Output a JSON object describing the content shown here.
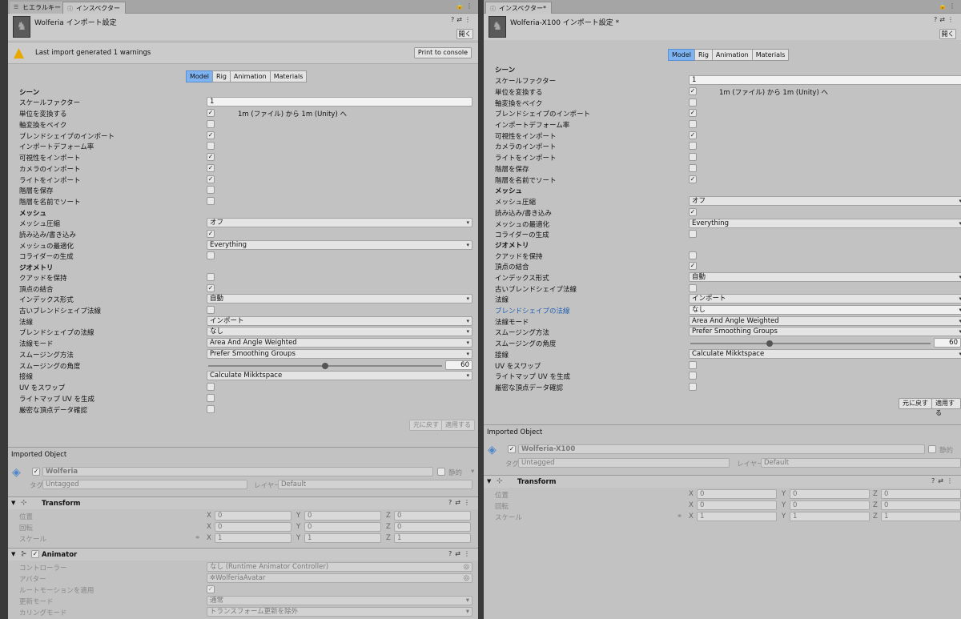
{
  "left": {
    "tabs": [
      {
        "label": "ヒエラルキー"
      },
      {
        "label": "インスペクター"
      }
    ],
    "title": "Wolferia インポート設定",
    "open_label": "開く",
    "warning": "Last import generated 1 warnings",
    "print_console": "Print to console",
    "mtabs": [
      "Model",
      "Rig",
      "Animation",
      "Materials"
    ],
    "scene_h": "シーン",
    "scale_factor_l": "スケールファクター",
    "scale_factor_v": "1",
    "convert_units_l": "単位を変換する",
    "convert_units_note": "1m (ファイル) から 1m (Unity) へ",
    "bake_axis_l": "軸変換をベイク",
    "blendshapes_l": "ブレンドシェイプのインポート",
    "deform_pct_l": "インポートデフォーム率",
    "visibility_l": "可視性をインポート",
    "cameras_l": "カメラのインポート",
    "lights_l": "ライトをインポート",
    "hierarchy_l": "階層を保存",
    "sort_l": "階層を名前でソート",
    "mesh_h": "メッシュ",
    "compression_l": "メッシュ圧縮",
    "compression_v": "オフ",
    "rw_l": "読み込み/書き込み",
    "optimize_l": "メッシュの最適化",
    "optimize_v": "Everything",
    "colliders_l": "コライダーの生成",
    "geometry_h": "ジオメトリ",
    "quads_l": "クアッドを保持",
    "weld_l": "頂点の結合",
    "index_l": "インデックス形式",
    "index_v": "自動",
    "legacy_l": "古いブレンドシェイプ法線",
    "normals_l": "法線",
    "normals_v": "インポート",
    "bs_normals_l": "ブレンドシェイプの法線",
    "bs_normals_v": "なし",
    "normals_mode_l": "法線モード",
    "normals_mode_v": "Area And Angle Weighted",
    "smoothing_src_l": "スムージング方法",
    "smoothing_src_v": "Prefer Smoothing Groups",
    "smoothing_angle_l": "スムージングの角度",
    "smoothing_angle_v": "60",
    "smoothing_angle_frac": 0.5,
    "tangents_l": "接線",
    "tangents_v": "Calculate Mikktspace",
    "swap_uv_l": "UV をスワップ",
    "lightmap_uv_l": "ライトマップ UV を生成",
    "strict_l": "厳密な頂点データ確認",
    "revert": "元に戻す",
    "apply": "適用する",
    "imported_object": "Imported Object",
    "obj_name": "Wolferia",
    "static_l": "静的",
    "tag_l": "タグ",
    "tag_v": "Untagged",
    "layer_l": "レイヤー",
    "layer_v": "Default",
    "transform_h": "Transform",
    "pos_l": "位置",
    "rot_l": "回転",
    "scale_l": "スケール",
    "pos": [
      "0",
      "0",
      "0"
    ],
    "rot": [
      "0",
      "0",
      "0"
    ],
    "scl": [
      "1",
      "1",
      "1"
    ],
    "animator_h": "Animator",
    "controller_l": "コントローラー",
    "controller_v": "なし (Runtime Animator Controller)",
    "avatar_l": "アバター",
    "avatar_v": "WolferiaAvatar",
    "root_motion_l": "ルートモーションを適用",
    "update_mode_l": "更新モード",
    "update_mode_v": "通常",
    "culling_l": "カリングモード",
    "culling_v": "トランスフォーム更新を除外"
  },
  "right": {
    "tab": "インスペクター*",
    "title": "Wolferia-X100 インポート設定 *",
    "open_label": "開く",
    "mtabs": [
      "Model",
      "Rig",
      "Animation",
      "Materials"
    ],
    "scene_h": "シーン",
    "scale_factor_l": "スケールファクター",
    "scale_factor_v": "1",
    "convert_units_l": "単位を変換する",
    "convert_units_note": "1m (ファイル) から 1m (Unity) へ",
    "bake_axis_l": "軸変換をベイク",
    "blendshapes_l": "ブレンドシェイプのインポート",
    "deform_pct_l": "インポートデフォーム率",
    "visibility_l": "可視性をインポート",
    "cameras_l": "カメラのインポート",
    "lights_l": "ライトをインポート",
    "hierarchy_l": "階層を保存",
    "sort_l": "階層を名前でソート",
    "mesh_h": "メッシュ",
    "compression_l": "メッシュ圧縮",
    "compression_v": "オフ",
    "rw_l": "読み込み/書き込み",
    "optimize_l": "メッシュの最適化",
    "optimize_v": "Everything",
    "colliders_l": "コライダーの生成",
    "geometry_h": "ジオメトリ",
    "quads_l": "クアッドを保持",
    "weld_l": "頂点の結合",
    "index_l": "インデックス形式",
    "index_v": "自動",
    "legacy_l": "古いブレンドシェイプ法線",
    "normals_l": "法線",
    "normals_v": "インポート",
    "bs_normals_l": "ブレンドシェイプの法線",
    "bs_normals_v": "なし",
    "normals_mode_l": "法線モード",
    "normals_mode_v": "Area And Angle Weighted",
    "smoothing_src_l": "スムージング方法",
    "smoothing_src_v": "Prefer Smoothing Groups",
    "smoothing_angle_l": "スムージングの角度",
    "smoothing_angle_v": "60",
    "smoothing_angle_frac": 0.33,
    "tangents_l": "接線",
    "tangents_v": "Calculate Mikktspace",
    "swap_uv_l": "UV をスワップ",
    "lightmap_uv_l": "ライトマップ UV を生成",
    "strict_l": "厳密な頂点データ確認",
    "revert": "元に戻す",
    "apply": "適用する",
    "imported_object": "Imported Object",
    "obj_name": "Wolferia-X100",
    "static_l": "静的",
    "tag_l": "タグ",
    "tag_v": "Untagged",
    "layer_l": "レイヤー",
    "layer_v": "Default",
    "transform_h": "Transform",
    "pos_l": "位置",
    "rot_l": "回転",
    "scale_l": "スケール",
    "pos": [
      "0",
      "0",
      "0"
    ],
    "rot": [
      "0",
      "0",
      "0"
    ],
    "scl": [
      "1",
      "1",
      "1"
    ]
  },
  "colors": {
    "selected_tab": "#7eb3f2",
    "warning_icon": "#e8a800",
    "link_label": "#1f5fb0"
  }
}
